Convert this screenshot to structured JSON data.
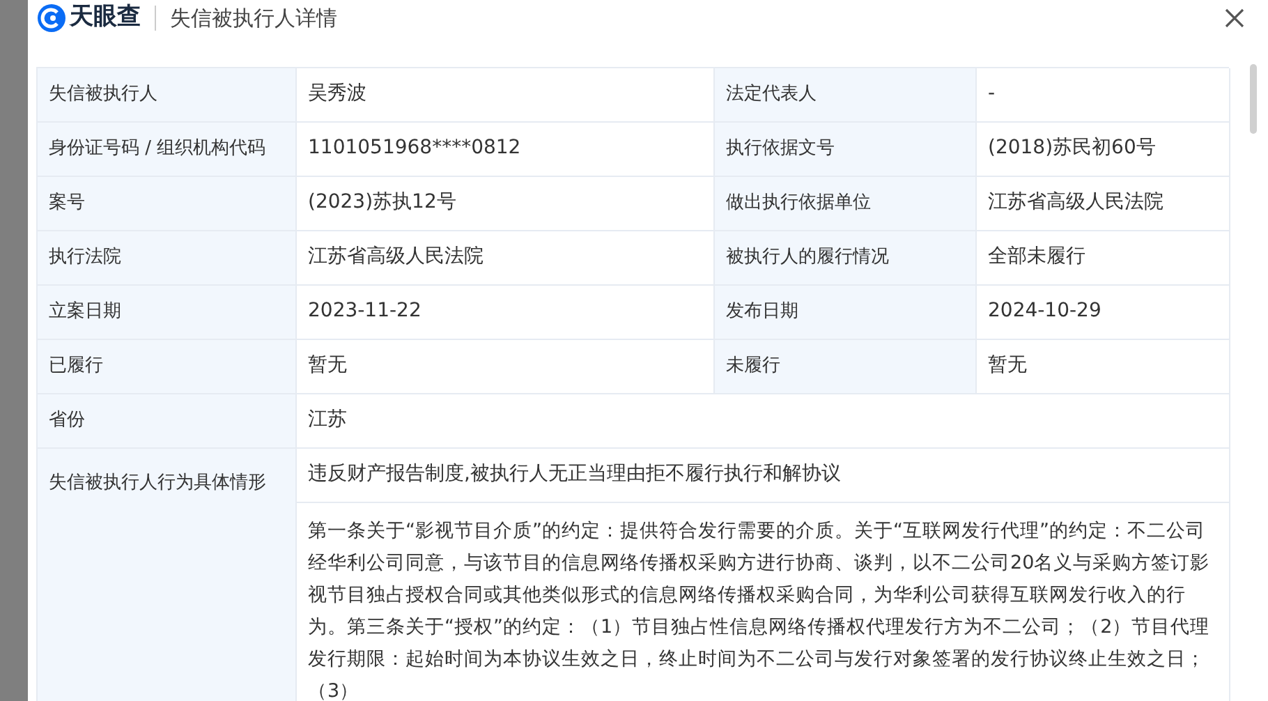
{
  "header": {
    "logo_text": "天眼查",
    "title": "失信被执行人详情"
  },
  "rows": [
    {
      "kind": "pair",
      "fields": [
        {
          "label": "失信被执行人",
          "value": "吴秀波"
        },
        {
          "label": "法定代表人",
          "value": "-"
        }
      ]
    },
    {
      "kind": "pair",
      "fields": [
        {
          "label": "身份证号码 / 组织机构代码",
          "value": "1101051968****0812"
        },
        {
          "label": "执行依据文号",
          "value": "(2018)苏民初60号"
        }
      ]
    },
    {
      "kind": "pair",
      "fields": [
        {
          "label": "案号",
          "value": "(2023)苏执12号"
        },
        {
          "label": "做出执行依据单位",
          "value": "江苏省高级人民法院"
        }
      ]
    },
    {
      "kind": "pair",
      "fields": [
        {
          "label": "执行法院",
          "value": "江苏省高级人民法院"
        },
        {
          "label": "被执行人的履行情况",
          "value": "全部未履行"
        }
      ]
    },
    {
      "kind": "pair",
      "fields": [
        {
          "label": "立案日期",
          "value": "2023-11-22"
        },
        {
          "label": "发布日期",
          "value": "2024-10-29"
        }
      ]
    },
    {
      "kind": "pair",
      "fields": [
        {
          "label": "已履行",
          "value": "暂无"
        },
        {
          "label": "未履行",
          "value": "暂无"
        }
      ]
    },
    {
      "kind": "wide",
      "fields": [
        {
          "label": "省份",
          "value": "江苏"
        }
      ]
    },
    {
      "kind": "detail",
      "fields": [
        {
          "label": "失信被执行人行为具体情形",
          "value": "违反财产报告制度,被执行人无正当理由拒不履行执行和解协议",
          "detail": "第一条关于“影视节目介质”的约定：提供符合发行需要的介质。关于“互联网发行代理”的约定：不二公司经华利公司同意，与该节目的信息网络传播权采购方进行协商、谈判，以不二公司20名义与采购方签订影视节目独占授权合同或其他类似形式的信息网络传播权采购合同，为华利公司获得互联网发行收入的行为。第三条关于“授权”的约定：（1）节目独占性信息网络传播权代理发行方为不二公司；（2）节目代理发行期限：起始时间为本协议生效之日，终止时间为不二公司与发行对象签署的发行协议终止生效之日；（3）"
        }
      ]
    }
  ]
}
